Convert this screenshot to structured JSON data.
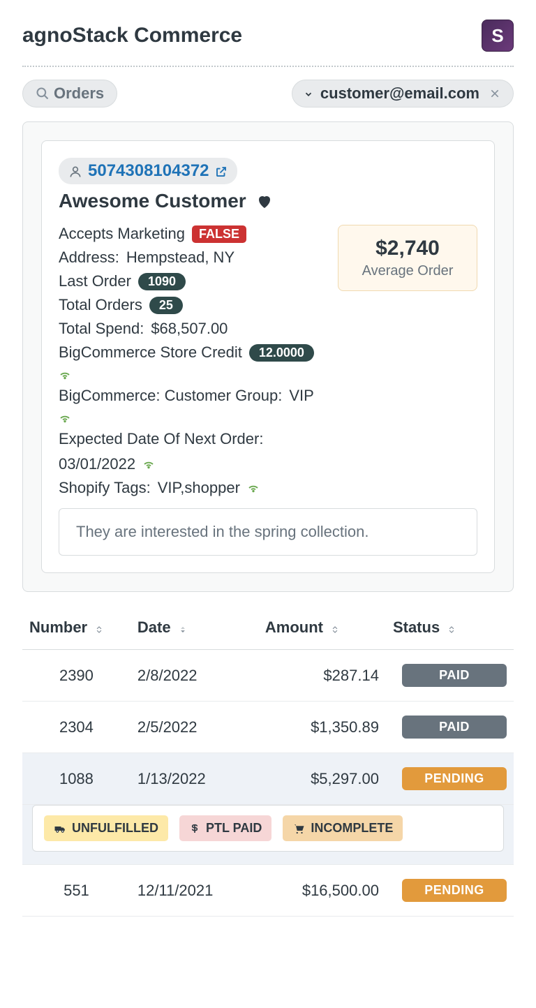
{
  "header": {
    "title": "agnoStack Commerce",
    "icon_letter": "S"
  },
  "toolbar": {
    "back_label": "Orders",
    "customer_email": "customer@email.com"
  },
  "customer": {
    "id": "5074308104372",
    "name": "Awesome Customer",
    "note": "They are interested in the spring collection.",
    "avg_order_value": "$2,740",
    "avg_order_label": "Average Order",
    "fields": {
      "marketing_label": "Accepts Marketing",
      "marketing_value": "FALSE",
      "address_label": "Address:",
      "address_value": "Hempstead, NY",
      "last_order_label": "Last Order",
      "last_order_value": "1090",
      "total_orders_label": "Total Orders",
      "total_orders_value": "25",
      "total_spend_label": "Total Spend:",
      "total_spend_value": "$68,507.00",
      "store_credit_label": "BigCommerce Store Credit",
      "store_credit_value": "12.0000",
      "customer_group_label": "BigCommerce: Customer Group:",
      "customer_group_value": "VIP",
      "next_order_label": "Expected Date Of Next Order:",
      "next_order_value": "03/01/2022",
      "shopify_tags_label": "Shopify Tags:",
      "shopify_tags_value": "VIP,shopper"
    }
  },
  "orders_table": {
    "columns": {
      "number": "Number",
      "date": "Date",
      "amount": "Amount",
      "status": "Status"
    },
    "rows": [
      {
        "number": "2390",
        "date": "2/8/2022",
        "amount": "$287.14",
        "status": "PAID",
        "status_class": "paid"
      },
      {
        "number": "2304",
        "date": "2/5/2022",
        "amount": "$1,350.89",
        "status": "PAID",
        "status_class": "paid"
      },
      {
        "number": "1088",
        "date": "1/13/2022",
        "amount": "$5,297.00",
        "status": "PENDING",
        "status_class": "pending",
        "expanded": true
      },
      {
        "number": "551",
        "date": "12/11/2021",
        "amount": "$16,500.00",
        "status": "PENDING",
        "status_class": "pending"
      }
    ],
    "expanded_tags": [
      {
        "icon": "truck",
        "label": "UNFULFILLED",
        "color": "yellow"
      },
      {
        "icon": "dollar",
        "label": "PTL PAID",
        "color": "pink"
      },
      {
        "icon": "cart",
        "label": "INCOMPLETE",
        "color": "orange"
      }
    ]
  }
}
